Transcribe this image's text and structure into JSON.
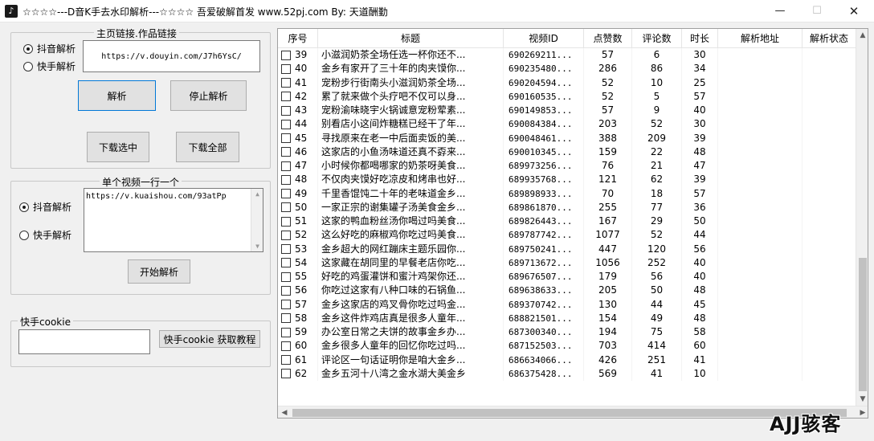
{
  "window": {
    "title": "☆☆☆☆---D音K手去水印解析---☆☆☆☆ 吾爱破解首发 www.52pj.com   By: 天道酬勤",
    "minimize": "—",
    "maximize": "☐",
    "close": "✕"
  },
  "douyin_group": {
    "title": "主页链接.作品链接",
    "radio_douyin": "抖音解析",
    "radio_kuaishou": "快手解析",
    "link_value": "https://v.douyin.com/J7h6YsC/",
    "btn_parse": "解析",
    "btn_stop": "停止解析",
    "btn_download_selected": "下载选中",
    "btn_download_all": "下载全部"
  },
  "single_group": {
    "title": "单个视频一行一个",
    "radio_douyin": "抖音解析",
    "radio_kuaishou": "快手解析",
    "text_value": "https://v.kuaishou.com/93atPp",
    "btn_start": "开始解析"
  },
  "cookie_group": {
    "title": "快手cookie",
    "input_value": "",
    "btn_tutorial": "快手cookie 获取教程"
  },
  "grid": {
    "headers": [
      "序号",
      "标题",
      "视频ID",
      "点赞数",
      "评论数",
      "时长",
      "解析地址",
      "解析状态"
    ],
    "rows": [
      {
        "no": "39",
        "title": "小滋润奶茶全场任选一杯你还不...",
        "vid": "690269211...",
        "likes": "57",
        "comments": "6",
        "dur": "30"
      },
      {
        "no": "40",
        "title": "金乡有家开了三十年的肉夹馍你...",
        "vid": "690235480...",
        "likes": "286",
        "comments": "86",
        "dur": "34"
      },
      {
        "no": "41",
        "title": "宠粉步行街南头小滋润奶茶全场...",
        "vid": "690204594...",
        "likes": "52",
        "comments": "10",
        "dur": "25"
      },
      {
        "no": "42",
        "title": "累了就来做个头疗吧不仅可以身...",
        "vid": "690160535...",
        "likes": "52",
        "comments": "5",
        "dur": "57"
      },
      {
        "no": "43",
        "title": "宠粉渝味晓宇火锅诚意宠粉荤素...",
        "vid": "690149853...",
        "likes": "57",
        "comments": "9",
        "dur": "40"
      },
      {
        "no": "44",
        "title": "别看店小这间炸糖糕已经干了年...",
        "vid": "690084384...",
        "likes": "203",
        "comments": "52",
        "dur": "30"
      },
      {
        "no": "45",
        "title": "寻找原来在老一中后面卖饭的美...",
        "vid": "690048461...",
        "likes": "388",
        "comments": "209",
        "dur": "39"
      },
      {
        "no": "46",
        "title": "这家店的小鱼汤味道还真不孬来...",
        "vid": "690010345...",
        "likes": "159",
        "comments": "22",
        "dur": "48"
      },
      {
        "no": "47",
        "title": "小时候你都喝哪家的奶茶呀美食...",
        "vid": "689973256...",
        "likes": "76",
        "comments": "21",
        "dur": "47"
      },
      {
        "no": "48",
        "title": "不仅肉夹馍好吃凉皮和烤串也好...",
        "vid": "689935768...",
        "likes": "121",
        "comments": "62",
        "dur": "39"
      },
      {
        "no": "49",
        "title": "千里香馄饨二十年的老味道金乡...",
        "vid": "689898933...",
        "likes": "70",
        "comments": "18",
        "dur": "57"
      },
      {
        "no": "50",
        "title": "一家正宗的谢集罐子汤美食金乡...",
        "vid": "689861870...",
        "likes": "255",
        "comments": "77",
        "dur": "36"
      },
      {
        "no": "51",
        "title": "这家的鸭血粉丝汤你喝过吗美食...",
        "vid": "689826443...",
        "likes": "167",
        "comments": "29",
        "dur": "50"
      },
      {
        "no": "52",
        "title": "这么好吃的麻椒鸡你吃过吗美食...",
        "vid": "689787742...",
        "likes": "1077",
        "comments": "52",
        "dur": "44"
      },
      {
        "no": "53",
        "title": "金乡超大的网红蹦床主题乐园你...",
        "vid": "689750241...",
        "likes": "447",
        "comments": "120",
        "dur": "56"
      },
      {
        "no": "54",
        "title": "这家藏在胡同里的早餐老店你吃...",
        "vid": "689713672...",
        "likes": "1056",
        "comments": "252",
        "dur": "40"
      },
      {
        "no": "55",
        "title": "好吃的鸡蛋灌饼和蜜汁鸡架你还...",
        "vid": "689676507...",
        "likes": "179",
        "comments": "56",
        "dur": "40"
      },
      {
        "no": "56",
        "title": "你吃过这家有八种口味的石锅鱼...",
        "vid": "689638633...",
        "likes": "205",
        "comments": "50",
        "dur": "48"
      },
      {
        "no": "57",
        "title": "金乡这家店的鸡叉骨你吃过吗金...",
        "vid": "689370742...",
        "likes": "130",
        "comments": "44",
        "dur": "45"
      },
      {
        "no": "58",
        "title": "金乡这件炸鸡店真是很多人童年...",
        "vid": "688821501...",
        "likes": "154",
        "comments": "49",
        "dur": "48"
      },
      {
        "no": "59",
        "title": "办公室日常之夫饼的故事金乡办...",
        "vid": "687300340...",
        "likes": "194",
        "comments": "75",
        "dur": "58"
      },
      {
        "no": "60",
        "title": "金乡很多人童年的回忆你吃过吗...",
        "vid": "687152503...",
        "likes": "703",
        "comments": "414",
        "dur": "60"
      },
      {
        "no": "61",
        "title": "评论区一句话证明你是咱大金乡...",
        "vid": "686634066...",
        "likes": "426",
        "comments": "251",
        "dur": "41"
      },
      {
        "no": "62",
        "title": "金乡五河十八湾之金水湖大美金乡",
        "vid": "686375428...",
        "likes": "569",
        "comments": "41",
        "dur": "10"
      }
    ]
  },
  "watermark": "AJJ骇客"
}
